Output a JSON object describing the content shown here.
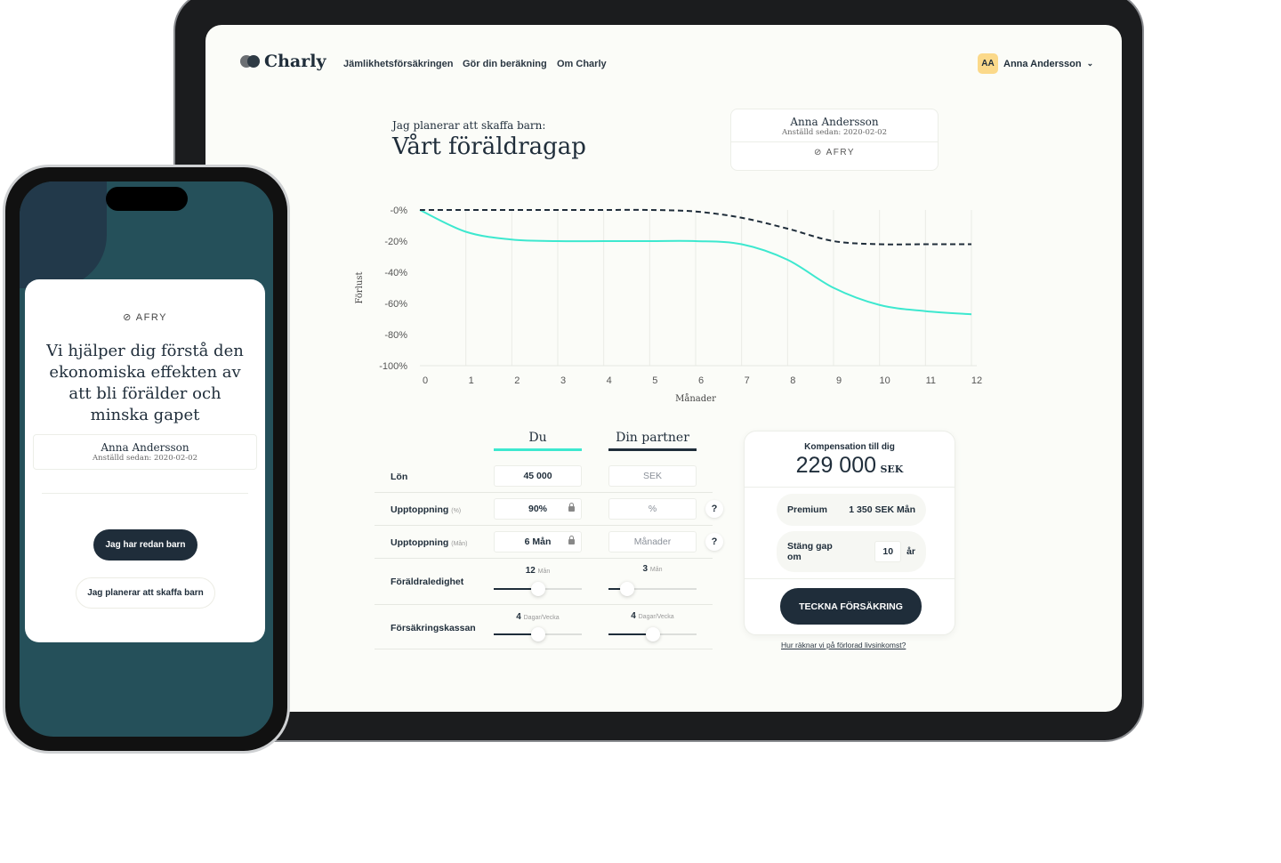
{
  "nav": {
    "brand": "Charly",
    "links": [
      "Jämlikhetsförsäkringen",
      "Gör din beräkning",
      "Om Charly"
    ],
    "user_initials": "AA",
    "user_name": "Anna Andersson"
  },
  "header": {
    "subtitle": "Jag planerar att skaffa barn:",
    "title": "Vårt föräldragap"
  },
  "employee_card": {
    "name": "Anna Andersson",
    "since": "Anställd sedan: 2020-02-02",
    "company": "AFRY"
  },
  "colors": {
    "accent": "#3de8cf",
    "dark": "#1f2d3a",
    "avatar": "#fbd98a",
    "phone_bg": "#25505a"
  },
  "chart_data": {
    "type": "line",
    "xlabel": "Månader",
    "ylabel": "Förlust",
    "x": [
      0,
      1,
      2,
      3,
      4,
      5,
      6,
      7,
      8,
      9,
      10,
      11,
      12
    ],
    "xlim": [
      0,
      12
    ],
    "ylim": [
      -100,
      0
    ],
    "yticks": [
      "-0%",
      "-20%",
      "-40%",
      "-60%",
      "-80%",
      "-100%"
    ],
    "ytick_values": [
      0,
      -20,
      -40,
      -60,
      -80,
      -100
    ],
    "grid": "vertical",
    "series": [
      {
        "style": "solid",
        "color": "#3de8cf",
        "values": [
          0,
          -14,
          -19,
          -20,
          -20,
          -20,
          -20,
          -22,
          -32,
          -50,
          -61,
          -65,
          -67
        ]
      },
      {
        "style": "dashed",
        "color": "#1f2d3a",
        "values": [
          0,
          0,
          0,
          0,
          0,
          0,
          -1,
          -5,
          -12,
          -20,
          -22,
          -22,
          -22
        ]
      }
    ]
  },
  "form": {
    "col_du": "Du",
    "col_partner": "Din partner",
    "rows": [
      {
        "label": "Lön",
        "unit": "",
        "du": "45 000",
        "partner_placeholder": "SEK"
      },
      {
        "label": "Upptoppning",
        "unit": "(%)",
        "du": "90%",
        "partner_placeholder": "%",
        "help": "?"
      },
      {
        "label": "Upptoppning",
        "unit": "(Mån)",
        "du": "6 Mån",
        "partner_placeholder": "Månader",
        "help": "?"
      }
    ],
    "sliders": [
      {
        "label": "Föräldraledighet",
        "du_value": "12",
        "du_unit": "Mån",
        "du_level": 0.5,
        "partner_value": "3",
        "partner_unit": "Mån",
        "partner_level": 0.21
      },
      {
        "label": "Försäkringskassan",
        "du_value": "4",
        "du_unit": "Dagar/Vecka",
        "du_level": 0.5,
        "partner_value": "4",
        "partner_unit": "Dagar/Vecka",
        "partner_level": 0.5
      }
    ]
  },
  "summary": {
    "title": "Kompensation till dig",
    "amount": "229 000",
    "currency": "SEK",
    "premium_label": "Premium",
    "premium_value": "1 350 SEK Mån",
    "close_label": "Stäng gap om",
    "close_value": "10",
    "close_unit": "år",
    "cta": "TECKNA FÖRSÄKRING",
    "link": "Hur räknar vi på förlorad livsinkomst?"
  },
  "phone": {
    "company": "AFRY",
    "headline": "Vi hjälper dig förstå den ekonomiska effekten av att bli förälder och minska gapet",
    "name": "Anna Andersson",
    "since": "Anställd sedan: 2020-02-02",
    "btn_primary": "Jag har redan barn",
    "btn_secondary": "Jag planerar att skaffa barn"
  }
}
